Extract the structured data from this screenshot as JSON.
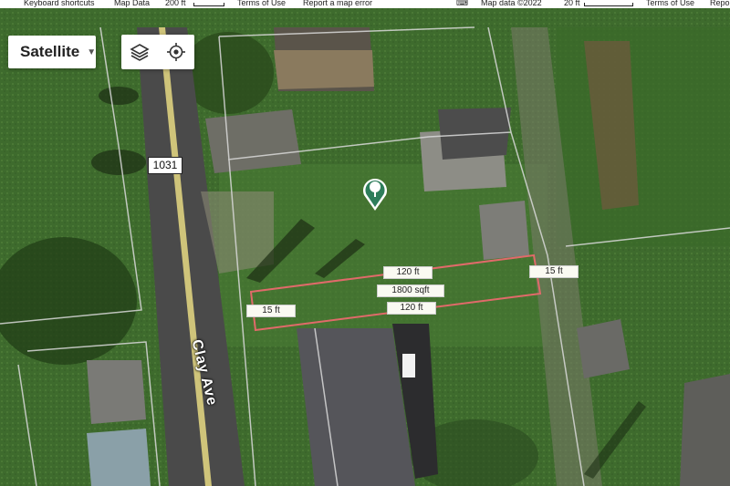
{
  "attribution_bar": {
    "left": {
      "keyboard_shortcuts": "Keyboard shortcuts",
      "map_data": "Map Data",
      "scale": "200 ft",
      "terms": "Terms of Use",
      "report": "Report a map error"
    },
    "right": {
      "map_data": "Map data ©2022",
      "scale": "20 ft",
      "terms": "Terms of Use",
      "report": "Repo"
    }
  },
  "map_type": {
    "label": "Satellite"
  },
  "controls": [
    "layers-icon",
    "my-location-icon"
  ],
  "route_shield": "1031",
  "street_label": "Clay Ave",
  "parcel": {
    "color": "#e06a6a",
    "top_length": "120 ft",
    "bottom_length": "120 ft",
    "area": "1800 sqft",
    "left_width": "15 ft",
    "right_width": "15 ft"
  },
  "marker": {
    "icon": "tree-icon",
    "color": "#2e7d5b"
  }
}
